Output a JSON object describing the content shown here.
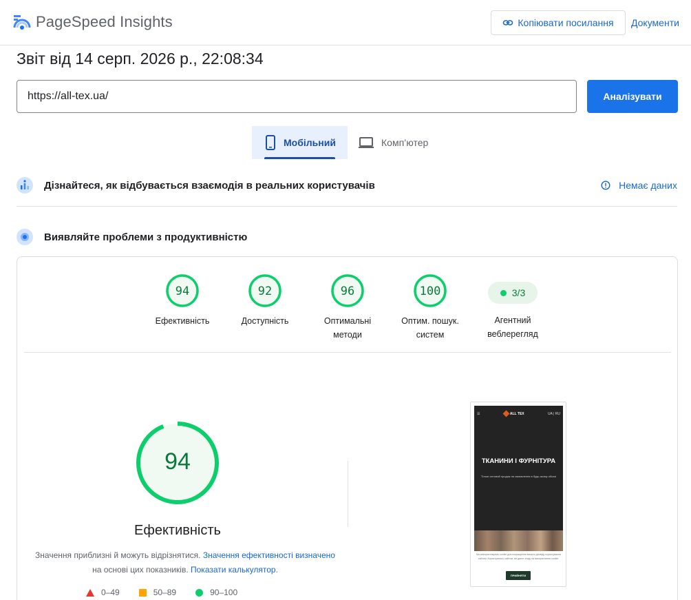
{
  "header": {
    "app_name": "PageSpeed Insights",
    "copy_link_label": "Копіювати посилання",
    "docs_label": "Документи"
  },
  "report": {
    "title": "Звіт від 14 серп. 2026 р., 22:08:34"
  },
  "search": {
    "url_value": "https://all-tex.ua/",
    "analyze_label": "Аналізувати"
  },
  "tabs": [
    {
      "label": "Мобільний",
      "active": true
    },
    {
      "label": "Комп’ютер",
      "active": false
    }
  ],
  "crux": {
    "title": "Дізнайтеся, як відбувається взаємодія в реальних користувачів",
    "status_label": "Немає даних"
  },
  "lab": {
    "title": "Виявляйте проблеми з продуктивністю"
  },
  "scores": [
    {
      "value": "94",
      "label": "Ефективність"
    },
    {
      "value": "92",
      "label": "Доступність"
    },
    {
      "value": "96",
      "label": "Оптимальні методи"
    },
    {
      "value": "100",
      "label": "Оптим. пошук. систем"
    }
  ],
  "agentic": {
    "value": "3/3",
    "label": "Агентний веблерегляд"
  },
  "performance": {
    "score": "94",
    "score_fraction": 0.94,
    "label": "Ефективність",
    "note_prefix": "Значення приблизні й можуть відрізнятися. ",
    "note_link1": "Значення ефективності визначено",
    "note_middle": " на основі цих показників. ",
    "note_link2": "Показати калькулятор",
    "note_suffix": "."
  },
  "legend": [
    {
      "range": "0–49",
      "color": "#e8362b"
    },
    {
      "range": "50–89",
      "color": "#ffa400"
    },
    {
      "range": "90–100",
      "color": "#0cce6b"
    }
  ],
  "screenshot": {
    "logo_text": "ALL TEX",
    "lang_text": "UA | RU",
    "headline": "ТКАНИНИ І ФУРНІТУРА",
    "subline": "Тільки оптовий продаж на замовлення в будь-якому обсязі",
    "cookie_text": "Ми використовуємо cookie для покращення вашого досвіду користування сайтом. Користуючись сайтом, ви даєте згоду на використання cookie.",
    "accept_label": "ПРИЙНЯТИ"
  },
  "colors": {
    "accent": "#1a73e8",
    "pass": "#0cce6b",
    "pass_text": "#0a7a3c",
    "pass_bg": "#e6f4ea"
  }
}
